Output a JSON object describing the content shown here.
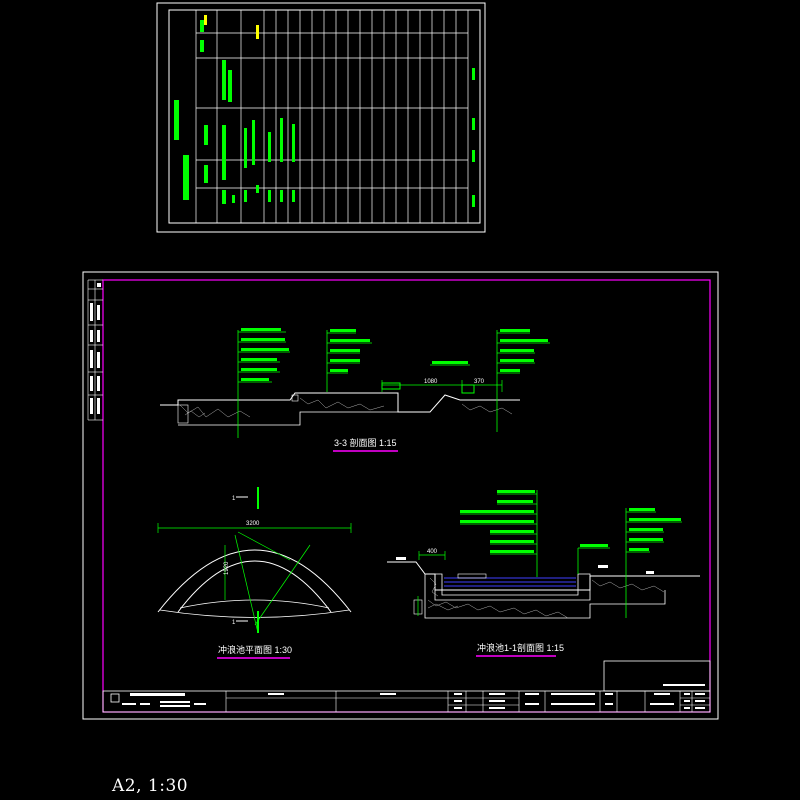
{
  "sheet": {
    "section_3_title": "3-3 剖面图  1:15",
    "fountain_plan_title": "冲浪池平面图  1:30",
    "fountain_section_title": "冲浪池1-1剖面图  1:15",
    "cut_marker": "1",
    "dim_1080": "1080",
    "dim_370": "370",
    "dim_400": "400",
    "dim_3200": "3200",
    "dim_1920": "1920"
  },
  "caption": "A2,   1:30",
  "colors": {
    "frame_white": "#ffffff",
    "border_magenta": "#ff00ff",
    "line_green": "#00ff00",
    "line_yellow": "#ffff00",
    "water_blue": "#4040ff",
    "hatch_gray": "#b0b0b0"
  }
}
